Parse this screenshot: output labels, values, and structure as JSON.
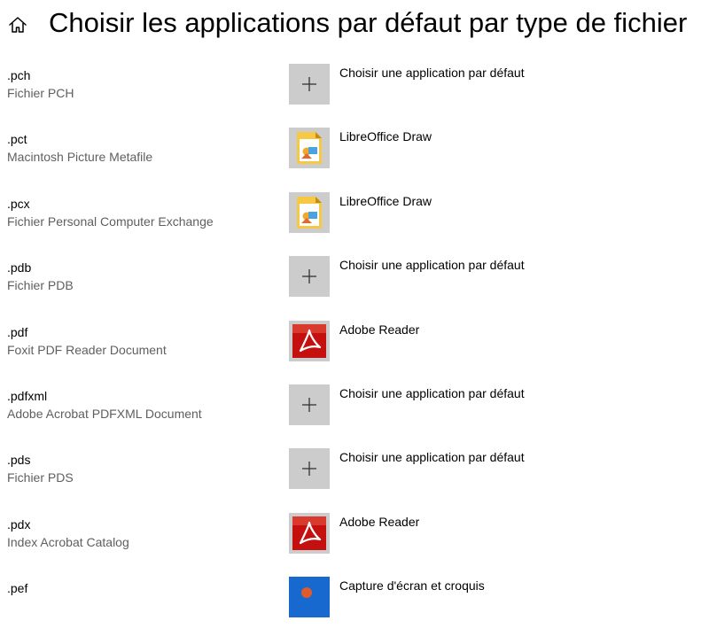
{
  "header": {
    "title": "Choisir les applications par défaut par type de fichier",
    "home_icon": "home-icon"
  },
  "colors": {
    "tile_bg": "#cccccc",
    "description_text": "#5f5f5f",
    "adobe_red": "#c4100e",
    "libreoffice_orange": "#f2a72b",
    "snip_blue": "#1769d0"
  },
  "rows": [
    {
      "ext": ".pch",
      "description": "Fichier PCH",
      "app": "Choisir une application par défaut",
      "icon": "plus-icon"
    },
    {
      "ext": ".pct",
      "description": "Macintosh Picture Metafile",
      "app": "LibreOffice Draw",
      "icon": "libreoffice-draw-icon"
    },
    {
      "ext": ".pcx",
      "description": "Fichier Personal Computer Exchange",
      "app": "LibreOffice Draw",
      "icon": "libreoffice-draw-icon"
    },
    {
      "ext": ".pdb",
      "description": "Fichier PDB",
      "app": "Choisir une application par défaut",
      "icon": "plus-icon"
    },
    {
      "ext": ".pdf",
      "description": "Foxit PDF Reader Document",
      "app": "Adobe Reader",
      "icon": "adobe-reader-icon"
    },
    {
      "ext": ".pdfxml",
      "description": "Adobe Acrobat PDFXML Document",
      "app": "Choisir une application par défaut",
      "icon": "plus-icon"
    },
    {
      "ext": ".pds",
      "description": "Fichier PDS",
      "app": "Choisir une application par défaut",
      "icon": "plus-icon"
    },
    {
      "ext": ".pdx",
      "description": "Index Acrobat Catalog",
      "app": "Adobe Reader",
      "icon": "adobe-reader-icon"
    },
    {
      "ext": ".pef",
      "description": "",
      "app": "Capture d'écran et croquis",
      "icon": "snip-sketch-icon"
    }
  ]
}
